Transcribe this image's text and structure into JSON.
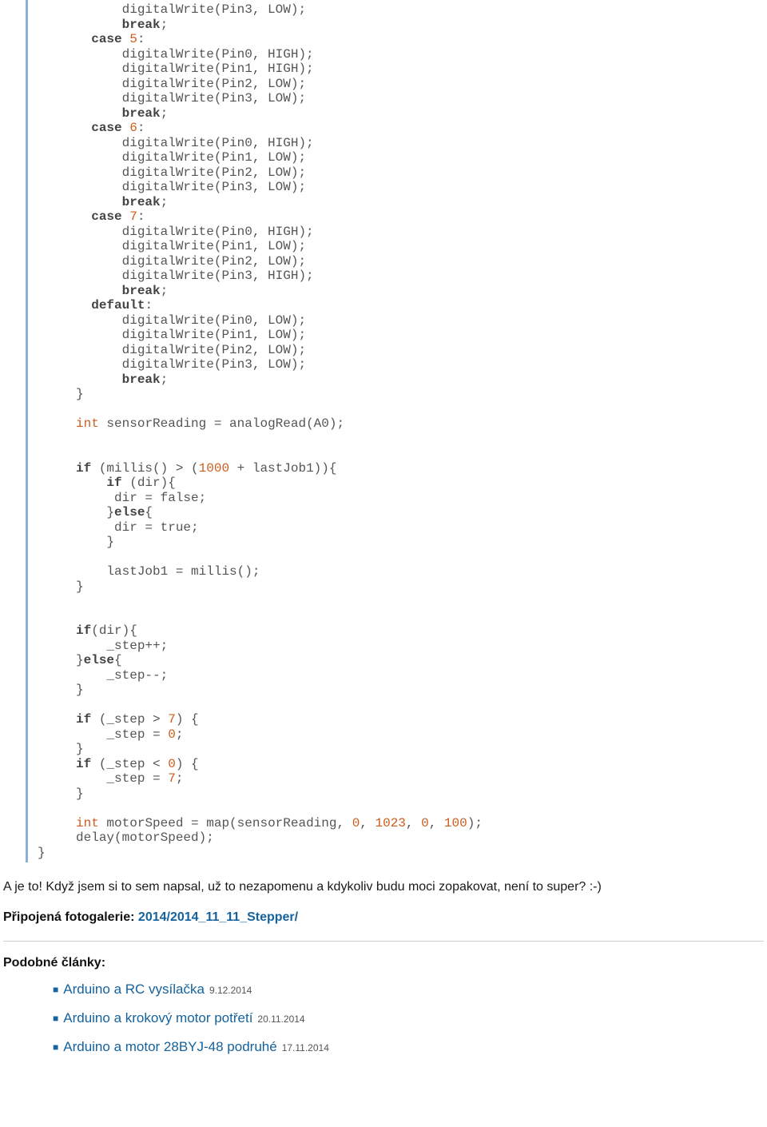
{
  "code": {
    "l01": "           digitalWrite(Pin3, LOW);",
    "l02a": "           ",
    "l02b": "break",
    "l02c": ";",
    "l03a": "       ",
    "l03b": "case",
    "l03c": " ",
    "l03d": "5",
    "l03e": ":",
    "l04": "           digitalWrite(Pin0, HIGH);",
    "l05": "           digitalWrite(Pin1, HIGH);",
    "l06": "           digitalWrite(Pin2, LOW);",
    "l07": "           digitalWrite(Pin3, LOW);",
    "l08a": "           ",
    "l08b": "break",
    "l08c": ";",
    "l09a": "       ",
    "l09b": "case",
    "l09c": " ",
    "l09d": "6",
    "l09e": ":",
    "l10": "           digitalWrite(Pin0, HIGH);",
    "l11": "           digitalWrite(Pin1, LOW);",
    "l12": "           digitalWrite(Pin2, LOW);",
    "l13": "           digitalWrite(Pin3, LOW);",
    "l14a": "           ",
    "l14b": "break",
    "l14c": ";",
    "l15a": "       ",
    "l15b": "case",
    "l15c": " ",
    "l15d": "7",
    "l15e": ":",
    "l16": "           digitalWrite(Pin0, HIGH);",
    "l17": "           digitalWrite(Pin1, LOW);",
    "l18": "           digitalWrite(Pin2, LOW);",
    "l19": "           digitalWrite(Pin3, HIGH);",
    "l20a": "           ",
    "l20b": "break",
    "l20c": ";",
    "l21a": "       ",
    "l21b": "default",
    "l21c": ":",
    "l22": "           digitalWrite(Pin0, LOW);",
    "l23": "           digitalWrite(Pin1, LOW);",
    "l24": "           digitalWrite(Pin2, LOW);",
    "l25": "           digitalWrite(Pin3, LOW);",
    "l26a": "           ",
    "l26b": "break",
    "l26c": ";",
    "l27": "     }",
    "l28": "",
    "l29a": "     ",
    "l29b": "int",
    "l29c": " sensorReading = analogRead(A0);",
    "l30": "",
    "l31": "",
    "l32a": "     ",
    "l32b": "if",
    "l32c": " (millis() > (",
    "l32d": "1000",
    "l32e": " + lastJob1)){",
    "l33a": "         ",
    "l33b": "if",
    "l33c": " (dir){",
    "l34": "          dir = false;",
    "l35a": "         }",
    "l35b": "else",
    "l35c": "{",
    "l36": "          dir = true;",
    "l37": "         }",
    "l38": "",
    "l39": "         lastJob1 = millis();",
    "l40": "     }",
    "l41": "",
    "l42": "",
    "l43a": "     ",
    "l43b": "if",
    "l43c": "(dir){",
    "l44": "         _step++;",
    "l45a": "     }",
    "l45b": "else",
    "l45c": "{",
    "l46": "         _step--;",
    "l47": "     }",
    "l48": "",
    "l49a": "     ",
    "l49b": "if",
    "l49c": " (_step > ",
    "l49d": "7",
    "l49e": ") {",
    "l50a": "         _step = ",
    "l50b": "0",
    "l50c": ";",
    "l51": "     }",
    "l52a": "     ",
    "l52b": "if",
    "l52c": " (_step < ",
    "l52d": "0",
    "l52e": ") {",
    "l53a": "         _step = ",
    "l53b": "7",
    "l53c": ";",
    "l54": "     }",
    "l55": "",
    "l56a": "     ",
    "l56b": "int",
    "l56c": " motorSpeed = map(sensorReading, ",
    "l56d": "0",
    "l56e": ", ",
    "l56f": "1023",
    "l56g": ", ",
    "l56h": "0",
    "l56i": ", ",
    "l56j": "100",
    "l56k": ");",
    "l57": "     delay(motorSpeed);",
    "l58": "}"
  },
  "paragraph": "A je to! Když jsem si to sem napsal, už to nezapomenu a kdykoliv budu moci zopakovat, není to super? :-)",
  "gallery": {
    "label": "Připojená fotogalerie: ",
    "link": "2014/2014_11_11_Stepper/"
  },
  "related": {
    "heading": "Podobné články:",
    "items": [
      {
        "title": "Arduino a RC vysílačka",
        "date": "9.12.2014"
      },
      {
        "title": "Arduino a krokový motor potřetí",
        "date": "20.11.2014"
      },
      {
        "title": "Arduino a motor 28BYJ-48 podruhé",
        "date": "17.11.2014"
      }
    ]
  }
}
